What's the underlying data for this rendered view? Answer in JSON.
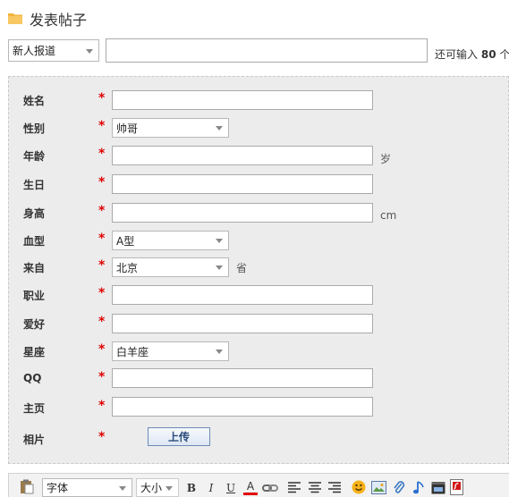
{
  "header": {
    "title": "发表帖子"
  },
  "post_bar": {
    "category": "新人报道",
    "title_value": "",
    "remaining_prefix": "还可输入",
    "remaining_count": "80",
    "remaining_suffix": "个"
  },
  "form": {
    "name": {
      "label": "姓名",
      "value": ""
    },
    "gender": {
      "label": "性别",
      "selected": "帅哥"
    },
    "age": {
      "label": "年龄",
      "value": "",
      "unit": "岁"
    },
    "birthday": {
      "label": "生日",
      "value": ""
    },
    "height": {
      "label": "身高",
      "value": "",
      "unit": "cm"
    },
    "blood": {
      "label": "血型",
      "selected": "A型"
    },
    "from": {
      "label": "来自",
      "selected": "北京",
      "unit": "省"
    },
    "job": {
      "label": "职业",
      "value": ""
    },
    "hobby": {
      "label": "爱好",
      "value": ""
    },
    "zodiac": {
      "label": "星座",
      "selected": "白羊座"
    },
    "qq": {
      "label": "QQ",
      "value": ""
    },
    "homepage": {
      "label": "主页",
      "value": ""
    },
    "photo": {
      "label": "相片",
      "button": "上传"
    },
    "required_mark": "*"
  },
  "toolbar": {
    "font_select": "字体",
    "size_select": "大小",
    "bold": "B",
    "italic": "I",
    "underline": "U",
    "font_color": "A"
  },
  "icons": [
    "folder-icon",
    "paste-icon",
    "link-icon",
    "align-left-icon",
    "align-center-icon",
    "align-right-icon",
    "emoticon-icon",
    "image-icon",
    "attachment-icon",
    "music-icon",
    "video-icon",
    "flash-icon"
  ],
  "colors": {
    "required": "#e00000",
    "panel_bg": "#ececec"
  }
}
